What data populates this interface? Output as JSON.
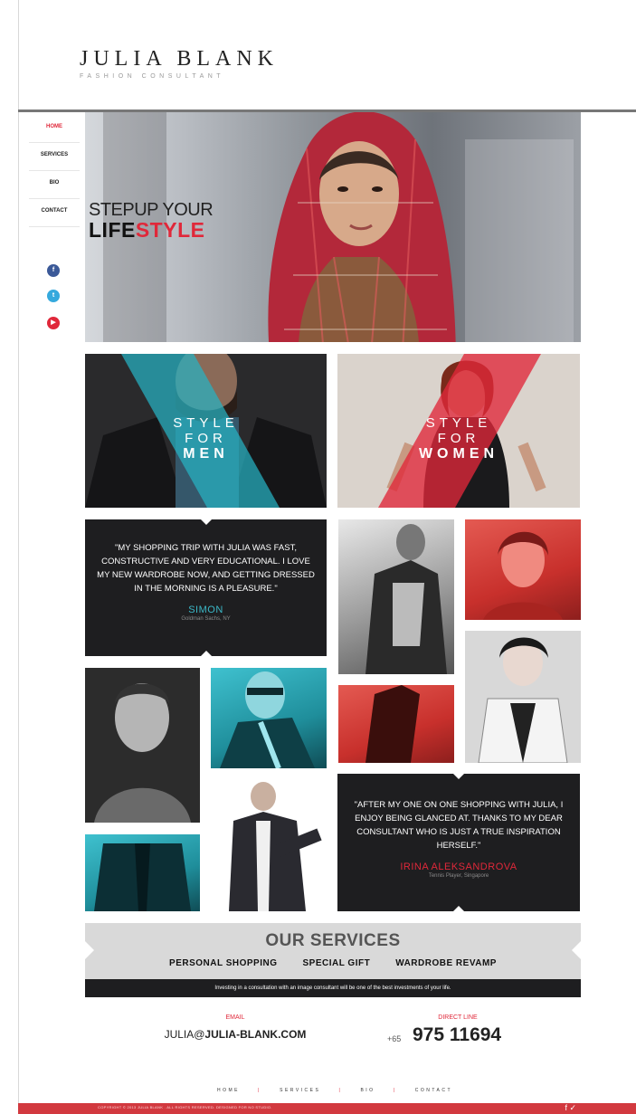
{
  "brand": {
    "name": "JULIA BLANK",
    "tagline": "FASHION CONSULTANT"
  },
  "nav": {
    "items": [
      {
        "label": "HOME",
        "active": true
      },
      {
        "label": "SERVICES"
      },
      {
        "label": "BIO"
      },
      {
        "label": "CONTACT"
      }
    ]
  },
  "social": {
    "facebook": "f",
    "twitter": "t",
    "youtube": "▶"
  },
  "hero": {
    "line1": "STEPUP YOUR",
    "line2_dark": "LIFE",
    "line2_red": "STYLE"
  },
  "tiles": {
    "men": {
      "line1": "STYLE",
      "line2": "FOR",
      "line3": "MEN"
    },
    "women": {
      "line1": "STYLE",
      "line2": "FOR",
      "line3": "WOMEN"
    }
  },
  "testimonials": [
    {
      "quote": "\"MY SHOPPING TRIP WITH JULIA WAS FAST, CONSTRUCTIVE AND VERY EDUCATIONAL. I LOVE MY NEW WARDROBE NOW, AND GETTING DRESSED IN THE MORNING IS A PLEASURE.\"",
      "name": "SIMON",
      "subtitle": "Goldman Sachs, NY"
    },
    {
      "quote": "\"AFTER MY ONE ON ONE SHOPPING WITH JULIA, I ENJOY BEING GLANCED AT. THANKS TO MY DEAR CONSULTANT WHO IS JUST A TRUE INSPIRATION HERSELF.\"",
      "name": "IRINA ALEKSANDROVA",
      "subtitle": "Tennis Player, Singapore"
    }
  ],
  "services": {
    "title": "OUR SERVICES",
    "items": [
      "PERSONAL SHOPPING",
      "SPECIAL GIFT",
      "WARDROBE REVAMP"
    ],
    "note": "Investing in a consultation with an image consultant will be one of the best investments of your life."
  },
  "contact": {
    "email_label": "EMAIL",
    "email_prefix": "JULIA@",
    "email_domain": "JULIA-BLANK.COM",
    "phone_label": "DIRECT LINE",
    "phone_prefix": "+65",
    "phone_number": "975 11694"
  },
  "footer": {
    "nav": [
      "HOME",
      "SERVICES",
      "BIO",
      "CONTACT"
    ],
    "separator": "|",
    "copyright": "COPYRIGHT © 2013 JULIA BLANK . ALL RIGHTS RESERVED. DESIGNED FOR NO STUDIO.",
    "icons": "f ✓"
  },
  "colors": {
    "accent": "#e0283a",
    "teal": "#3bb8c7",
    "dark": "#1e1e20",
    "footer": "#d2393f"
  }
}
